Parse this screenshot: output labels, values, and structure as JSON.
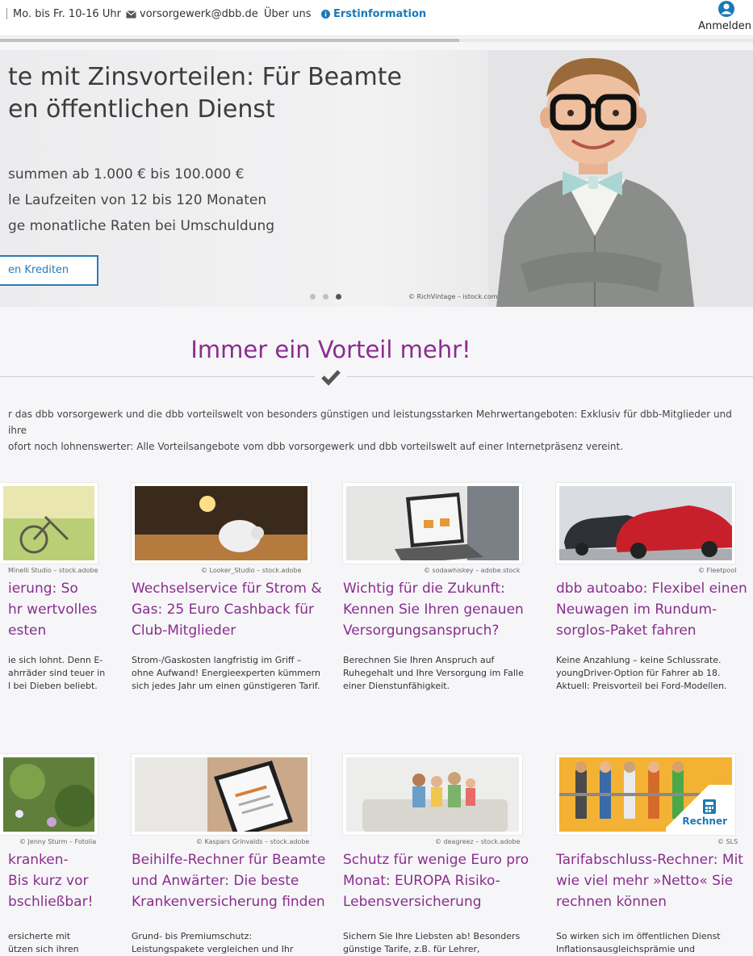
{
  "topbar": {
    "hours": "Mo. bis Fr. 10-16 Uhr",
    "email": "vorsorgewerk@dbb.de",
    "about": "Über uns",
    "info": "Erstinformation",
    "login": "Anmelden"
  },
  "hero": {
    "title": "te mit Zinsvorteilen: Für Beamte en öffentlichen Dienst",
    "title_line1": "te mit Zinsvorteilen: Für Beamte",
    "title_line2": "en öffentlichen Dienst",
    "bullets": [
      "summen ab 1.000 € bis 100.000 €",
      "le Laufzeiten von 12 bis 120 Monaten",
      "ge monatliche Raten bei Umschuldung"
    ],
    "cta": "en Krediten",
    "credit": "© RichVintage – istock.com",
    "slides_total": 3,
    "slide_active": 3,
    "loader_progress": 0.61
  },
  "section": {
    "heading": "Immer ein Vorteil mehr!",
    "intro_line1": "r das dbb vorsorgewerk und die dbb vorteilswelt von besonders günstigen und leistungsstarken Mehrwertangeboten: Exklusiv für dbb-Mitglieder und ihre",
    "intro_line2": "ofort noch lohnenswerter: Alle Vorteilsangebote vom dbb vorsorgewerk und dbb vorteilswelt auf einer Internetpräsenz vereint."
  },
  "cards": [
    {
      "credit": "Minelli Studio – stock.adobe",
      "title": [
        "ierung: So",
        "hr wertvolles",
        "esten"
      ],
      "desc": [
        "ie sich lohnt. Denn E-",
        "ahrräder sind teuer in",
        "l bei Dieben beliebt."
      ]
    },
    {
      "credit": "© Looker_Studio – stock.adobe",
      "title": [
        "Wechselservice für Strom &",
        "Gas: 25 Euro Cashback für",
        "Club-Mitglieder"
      ],
      "desc": [
        "Strom-/Gaskosten langfristig im Griff –",
        "ohne Aufwand! Energieexperten kümmern",
        "sich jedes Jahr um einen günstigeren Tarif."
      ]
    },
    {
      "credit": "© sodawhiskey – adobe.stock",
      "title": [
        "Wichtig für die Zukunft:",
        "Kennen Sie Ihren genauen",
        "Versorgungsanspruch?"
      ],
      "desc": [
        "Berechnen Sie Ihren Anspruch auf",
        "Ruhegehalt und Ihre Versorgung im Falle",
        "einer Dienstunfähigkeit."
      ]
    },
    {
      "credit": "© Fleetpool",
      "title": [
        "dbb autoabo: Flexibel einen",
        "Neuwagen im Rundum-",
        "sorglos-Paket fahren"
      ],
      "desc": [
        "Keine Anzahlung – keine Schlussrate.",
        "youngDriver-Option für Fahrer ab 18.",
        "Aktuell: Preisvorteil bei Ford-Modellen."
      ]
    },
    {
      "credit": "© Jenny Sturm – Fotolia",
      "title": [
        "kranken-",
        "Bis kurz vor",
        "bschließbar!"
      ],
      "desc": [
        "ersicherte mit",
        "ützen sich ihren"
      ]
    },
    {
      "credit": "© Kaspars Grinvalds – stock.adobe",
      "title": [
        "Beihilfe-Rechner für Beamte",
        "und Anwärter: Die beste",
        "Krankenversicherung finden"
      ],
      "desc": [
        "Grund- bis Premiumschutz:",
        "Leistungspakete vergleichen und  Ihr"
      ]
    },
    {
      "credit": "© deagreez – stock.adobe",
      "title": [
        "Schutz für wenige Euro pro",
        "Monat: EUROPA Risiko-",
        "Lebensversicherung"
      ],
      "desc": [
        "Sichern Sie Ihre Liebsten ab! Besonders",
        "günstige Tarife, z.B. für Lehrer,"
      ]
    },
    {
      "credit": "© SLS",
      "title": [
        "Tarifabschluss-Rechner: Mit",
        "wie viel mehr »Netto« Sie",
        "rechnen können"
      ],
      "desc": [
        "So wirken sich im öffentlichen Dienst",
        "Inflationsausgleichsprämie und"
      ],
      "badge": "Rechner"
    }
  ],
  "colors": {
    "accent_purple": "#8a2d8e",
    "link_blue": "#1a7ab5",
    "cta_blue": "#2a7bb8"
  }
}
